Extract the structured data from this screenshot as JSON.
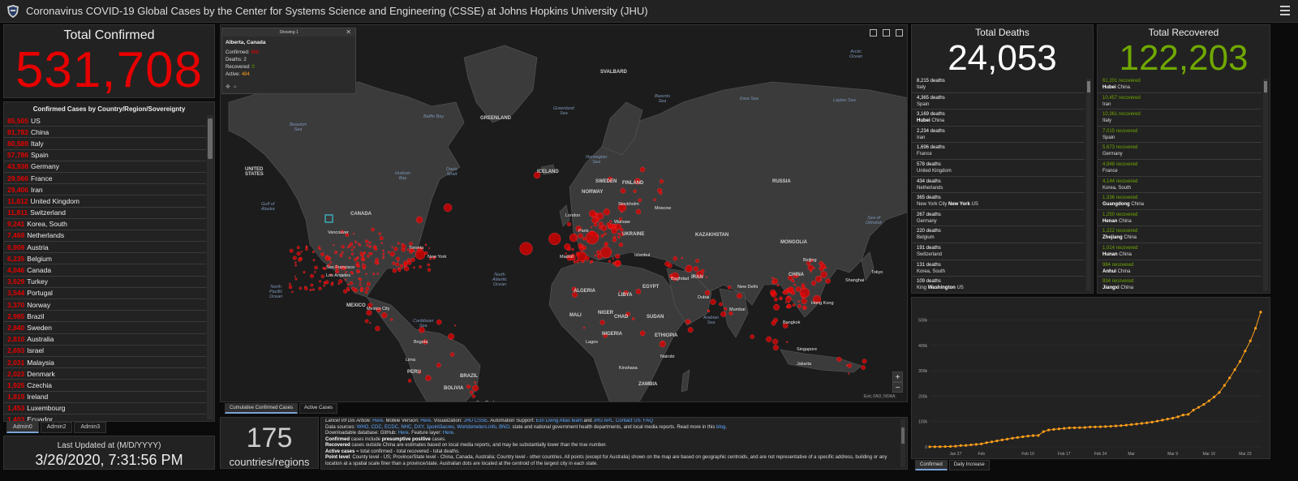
{
  "header": {
    "title": "Coronavirus COVID-19 Global Cases by the Center for Systems Science and Engineering (CSSE) at Johns Hopkins University (JHU)"
  },
  "total_confirmed": {
    "label": "Total Confirmed",
    "value": "531,708"
  },
  "country_list": {
    "title": "Confirmed Cases by Country/Region/Sovereignty",
    "rows": [
      {
        "count": "85,505",
        "name": "US"
      },
      {
        "count": "81,782",
        "name": "China"
      },
      {
        "count": "80,589",
        "name": "Italy"
      },
      {
        "count": "57,786",
        "name": "Spain"
      },
      {
        "count": "43,938",
        "name": "Germany"
      },
      {
        "count": "29,566",
        "name": "France"
      },
      {
        "count": "29,406",
        "name": "Iran"
      },
      {
        "count": "11,812",
        "name": "United Kingdom"
      },
      {
        "count": "11,811",
        "name": "Switzerland"
      },
      {
        "count": "9,241",
        "name": "Korea, South"
      },
      {
        "count": "7,469",
        "name": "Netherlands"
      },
      {
        "count": "6,909",
        "name": "Austria"
      },
      {
        "count": "6,235",
        "name": "Belgium"
      },
      {
        "count": "4,046",
        "name": "Canada"
      },
      {
        "count": "3,629",
        "name": "Turkey"
      },
      {
        "count": "3,544",
        "name": "Portugal"
      },
      {
        "count": "3,370",
        "name": "Norway"
      },
      {
        "count": "2,985",
        "name": "Brazil"
      },
      {
        "count": "2,840",
        "name": "Sweden"
      },
      {
        "count": "2,810",
        "name": "Australia"
      },
      {
        "count": "2,693",
        "name": "Israel"
      },
      {
        "count": "2,031",
        "name": "Malaysia"
      },
      {
        "count": "2,023",
        "name": "Denmark"
      },
      {
        "count": "1,925",
        "name": "Czechia"
      },
      {
        "count": "1,819",
        "name": "Ireland"
      },
      {
        "count": "1,453",
        "name": "Luxembourg"
      },
      {
        "count": "1,403",
        "name": "Ecuador"
      }
    ]
  },
  "admin_tabs": [
    "Admin0",
    "Admin2",
    "Admin3"
  ],
  "last_updated": {
    "label": "Last Updated at (M/D/YYYY)",
    "value": "3/26/2020, 7:31:56 PM"
  },
  "popup": {
    "header": "Showing 1",
    "title": "Alberta, Canada",
    "confirmed_label": "Confirmed:",
    "confirmed": "486",
    "deaths_label": "Deaths:",
    "deaths": "2",
    "recovered_label": "Recovered:",
    "recovered": "0",
    "active_label": "Active:",
    "active": "484"
  },
  "map": {
    "ocean_labels": [
      {
        "text": "Beaufort\nSea"
      },
      {
        "text": "Baffin Bay"
      },
      {
        "text": "Greenland\nSea"
      },
      {
        "text": "Barents\nSea"
      },
      {
        "text": "Kara Sea"
      },
      {
        "text": "Laptev Sea"
      },
      {
        "text": "Arctic\nOcean"
      },
      {
        "text": "Gulf of\nAlaska"
      },
      {
        "text": "Hudson\nBay"
      },
      {
        "text": "Davis\nStrait"
      },
      {
        "text": "Norwegian\nSea"
      },
      {
        "text": "North\nPacific\nOcean"
      },
      {
        "text": "North\nAtlantic\nOcean"
      },
      {
        "text": "Sea of\nOkhotsk"
      },
      {
        "text": "Arabian\nSea"
      },
      {
        "text": "Caribbean\nSea"
      }
    ],
    "country_labels": [
      "UNITED\nSTATES",
      "GREENLAND",
      "SVALBARD",
      "CANADA",
      "RUSSIA",
      "KAZAKHSTAN",
      "MONGOLIA",
      "CHINA",
      "UKRAINE",
      "MEXICO",
      "ALGERIA",
      "LIBYA",
      "EGYPT",
      "SUDAN",
      "MALI",
      "NIGER",
      "CHAD",
      "NIGERIA",
      "ETHIOPIA",
      "BRAZIL",
      "PERU",
      "BOLIVIA",
      "ZAMBIA",
      "SWEDEN",
      "FINLAND",
      "NORWAY",
      "IRAN",
      "ICELAND"
    ],
    "city_labels": [
      "Vancouver",
      "San Francisco",
      "Los Angeles",
      "Toronto",
      "New York",
      "Mexico City",
      "Moscow",
      "Warsaw",
      "Madrid",
      "Istanbul",
      "Baghdad",
      "Dubai",
      "New Delhi",
      "Mumbai",
      "Beijing",
      "Shanghai",
      "Tokyo",
      "Hong Kong",
      "Bangkok",
      "Singapore",
      "Jakarta",
      "Bogota",
      "Lima",
      "Sao Paulo",
      "London",
      "Paris",
      "Stockholm",
      "Kinshasa",
      "Nairobi",
      "Lagos"
    ],
    "attribution": "Esri, FAO, NOAA",
    "zoom_in": "+",
    "zoom_out": "−"
  },
  "map_tabs": [
    "Cumulative Confirmed Cases",
    "Active Cases"
  ],
  "countries_regions": {
    "value": "175",
    "label": "countries/regions"
  },
  "info": {
    "l1_pre": "Lancet Inf Dis Article: ",
    "l1_here1": "Here",
    "l1_mid": ". Mobile Version: ",
    "l1_here2": "Here",
    "l1_viz": ". Visualization: ",
    "l1_jhu": "JHU CSSE",
    "l1_auto": ". Automation Support: ",
    "l1_esri": "Esri Living Atlas team",
    "l1_and": " and ",
    "l1_apl": "JHU APL",
    "l1_contact": ". Contact US",
    "l1_faq": ". FAQ",
    "l2_pre": "Data sources: ",
    "l2_sources": "WHO, CDC, ECDC, NHC, DXY, 1point3acres, Worldometers.info, BNO,",
    "l2_post": " state and national government health departments, and local media reports.  Read more in this ",
    "l2_blog": "blog",
    "l3": "Downloadable database: GitHub: ",
    "l3_here": "Here",
    "l3_post": ". Feature layer: ",
    "l3_here2": "Here",
    "l4_b": "Confirmed",
    "l4": " cases include ",
    "l4_b2": "presumptive positive",
    "l4_post": " cases.",
    "l5_b": "Recovered",
    "l5": " cases outside China are estimates based on local media reports, and may be substantially lower than the true number.",
    "l6_b": "Active cases",
    "l6": " = total confirmed - total recovered - total deaths.",
    "l7_b": "Point level",
    "l7": ": County level - US; Province/State level - China, Canada, Australia; Country level - other countries. All points (except for Australia) shown on the map are based on geographic centroids, and are not representative of a specific address, building or any location at a spatial scale finer than a province/state. Australian dots are located at the centroid of the largest city in each state."
  },
  "total_deaths": {
    "label": "Total Deaths",
    "value": "24,053",
    "rows": [
      {
        "num": "8,215 deaths",
        "place": "Italy",
        "bold": ""
      },
      {
        "num": "4,365 deaths",
        "place": "Spain",
        "bold": ""
      },
      {
        "num": "3,169 deaths",
        "place": " China",
        "bold": "Hubei"
      },
      {
        "num": "2,234 deaths",
        "place": "Iran",
        "bold": ""
      },
      {
        "num": "1,696 deaths",
        "place": "France",
        "bold": ""
      },
      {
        "num": "578 deaths",
        "place": "United Kingdom",
        "bold": ""
      },
      {
        "num": "434 deaths",
        "place": "Netherlands",
        "bold": ""
      },
      {
        "num": "365 deaths",
        "place": "New York City ",
        "bold": "New York",
        "suffix": " US"
      },
      {
        "num": "267 deaths",
        "place": "Germany",
        "bold": ""
      },
      {
        "num": "220 deaths",
        "place": "Belgium",
        "bold": ""
      },
      {
        "num": "191 deaths",
        "place": "Switzerland",
        "bold": ""
      },
      {
        "num": "131 deaths",
        "place": "Korea, South",
        "bold": ""
      },
      {
        "num": "109 deaths",
        "place": "King ",
        "bold": "Washington",
        "suffix": " US"
      }
    ]
  },
  "total_recovered": {
    "label": "Total Recovered",
    "value": "122,203",
    "rows": [
      {
        "num": "61,201 recovered",
        "bold": "Hubei",
        "place": " China"
      },
      {
        "num": "10,457 recovered",
        "bold": "",
        "place": "Iran"
      },
      {
        "num": "10,361 recovered",
        "bold": "",
        "place": "Italy"
      },
      {
        "num": "7,015 recovered",
        "bold": "",
        "place": "Spain"
      },
      {
        "num": "5,673 recovered",
        "bold": "",
        "place": "Germany"
      },
      {
        "num": "4,948 recovered",
        "bold": "",
        "place": "France"
      },
      {
        "num": "4,144 recovered",
        "bold": "",
        "place": "Korea, South"
      },
      {
        "num": "1,336 recovered",
        "bold": "Guangdong",
        "place": " China"
      },
      {
        "num": "1,250 recovered",
        "bold": "Henan",
        "place": " China"
      },
      {
        "num": "1,222 recovered",
        "bold": "Zhejiang",
        "place": " China"
      },
      {
        "num": "1,014 recovered",
        "bold": "Hunan",
        "place": " China"
      },
      {
        "num": "984 recovered",
        "bold": "Anhui",
        "place": " China"
      },
      {
        "num": "934 recovered",
        "bold": "Jiangxi",
        "place": " China"
      }
    ]
  },
  "chart_data": {
    "type": "line",
    "title": "",
    "xlabel": "",
    "ylabel": "",
    "x_tick_labels": [
      "Jan 27",
      "Feb",
      "Feb 10",
      "Feb 17",
      "Feb 24",
      "Mar",
      "Mar 9",
      "Mar 16",
      "Mar 23"
    ],
    "y_tick_labels": [
      "0",
      "100k",
      "200k",
      "300k",
      "400k",
      "500k"
    ],
    "ylim": [
      0,
      550000
    ],
    "x": [
      "Jan 22",
      "Jan 23",
      "Jan 24",
      "Jan 25",
      "Jan 26",
      "Jan 27",
      "Jan 28",
      "Jan 29",
      "Jan 30",
      "Jan 31",
      "Feb 1",
      "Feb 2",
      "Feb 3",
      "Feb 4",
      "Feb 5",
      "Feb 6",
      "Feb 7",
      "Feb 8",
      "Feb 9",
      "Feb 10",
      "Feb 11",
      "Feb 12",
      "Feb 13",
      "Feb 14",
      "Feb 15",
      "Feb 16",
      "Feb 17",
      "Feb 18",
      "Feb 19",
      "Feb 20",
      "Feb 21",
      "Feb 22",
      "Feb 23",
      "Feb 24",
      "Feb 25",
      "Feb 26",
      "Feb 27",
      "Feb 28",
      "Feb 29",
      "Mar 1",
      "Mar 2",
      "Mar 3",
      "Mar 4",
      "Mar 5",
      "Mar 6",
      "Mar 7",
      "Mar 8",
      "Mar 9",
      "Mar 10",
      "Mar 11",
      "Mar 12",
      "Mar 13",
      "Mar 14",
      "Mar 15",
      "Mar 16",
      "Mar 17",
      "Mar 18",
      "Mar 19",
      "Mar 20",
      "Mar 21",
      "Mar 22",
      "Mar 23",
      "Mar 24",
      "Mar 25",
      "Mar 26"
    ],
    "series": [
      {
        "values": [
          555,
          654,
          941,
          1434,
          2118,
          2927,
          5578,
          6166,
          8234,
          9927,
          12038,
          16787,
          19881,
          23892,
          27635,
          30817,
          34391,
          37120,
          40150,
          42762,
          44802,
          45221,
          60368,
          66885,
          69030,
          71224,
          73258,
          75136,
          75639,
          76197,
          76819,
          78572,
          78958,
          79561,
          80406,
          81388,
          82746,
          84112,
          86011,
          88369,
          90306,
          92840,
          95120,
          97886,
          101801,
          105847,
          109821,
          113590,
          118620,
          125875,
          128352,
          145205,
          156101,
          167454,
          181574,
          197102,
          214821,
          242570,
          272208,
          304507,
          336953,
          378231,
          418041,
          467653,
          531708
        ],
        "color": "#ff9f1a"
      }
    ]
  },
  "chart_tabs": [
    "Confirmed",
    "Daily Increase"
  ]
}
